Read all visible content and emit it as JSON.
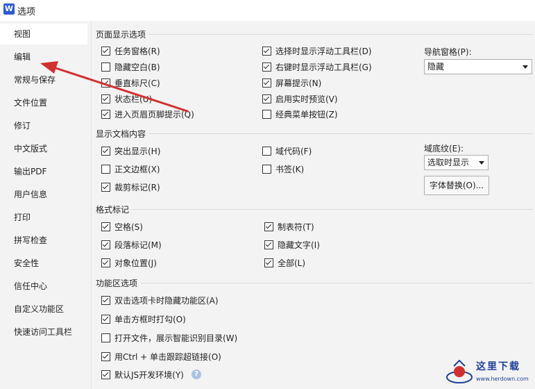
{
  "window": {
    "title": "选项",
    "app_icon": "W"
  },
  "sidebar": {
    "items": [
      {
        "label": "视图",
        "active": true
      },
      {
        "label": "编辑"
      },
      {
        "label": "常规与保存"
      },
      {
        "label": "文件位置"
      },
      {
        "label": "修订"
      },
      {
        "label": "中文版式"
      },
      {
        "label": "输出PDF"
      },
      {
        "label": "用户信息"
      },
      {
        "label": "打印"
      },
      {
        "label": "拼写检查"
      },
      {
        "label": "安全性"
      },
      {
        "label": "信任中心"
      },
      {
        "label": "自定义功能区"
      },
      {
        "label": "快速访问工具栏"
      }
    ]
  },
  "page_display": {
    "title": "页面显示选项",
    "left": [
      {
        "label": "任务窗格(R)",
        "checked": true
      },
      {
        "label": "隐藏空白(B)",
        "checked": false
      },
      {
        "label": "垂直标尺(C)",
        "checked": true
      },
      {
        "label": "状态栏(U)",
        "checked": true
      },
      {
        "label": "进入页眉页脚提示(Q)",
        "checked": true
      }
    ],
    "right": [
      {
        "label": "选择时显示浮动工具栏(D)",
        "checked": true
      },
      {
        "label": "右键时显示浮动工具栏(G)",
        "checked": true
      },
      {
        "label": "屏幕提示(N)",
        "checked": true
      },
      {
        "label": "启用实时预览(V)",
        "checked": true
      },
      {
        "label": "经典菜单按钮(Z)",
        "checked": false
      }
    ],
    "nav_pane_label": "导航窗格(P):",
    "nav_pane_value": "隐藏"
  },
  "doc_content": {
    "title": "显示文档内容",
    "left": [
      {
        "label": "突出显示(H)",
        "checked": true
      },
      {
        "label": "正文边框(X)",
        "checked": false
      },
      {
        "label": "裁剪标记(R)",
        "checked": true
      }
    ],
    "right": [
      {
        "label": "域代码(F)",
        "checked": false
      },
      {
        "label": "书签(K)",
        "checked": false
      }
    ],
    "field_shading_label": "域底纹(E):",
    "field_shading_value": "选取时显示",
    "font_replace_button": "字体替换(O)..."
  },
  "format_marks": {
    "title": "格式标记",
    "left": [
      {
        "label": "空格(S)",
        "checked": true
      },
      {
        "label": "段落标记(M)",
        "checked": true
      },
      {
        "label": "对象位置(J)",
        "checked": true
      }
    ],
    "right": [
      {
        "label": "制表符(T)",
        "checked": true
      },
      {
        "label": "隐藏文字(I)",
        "checked": true
      },
      {
        "label": "全部(L)",
        "checked": true
      }
    ]
  },
  "ribbon": {
    "title": "功能区选项",
    "items": [
      {
        "label": "双击选项卡时隐藏功能区(A)",
        "checked": true
      },
      {
        "label": "单击方框时打勾(O)",
        "checked": true
      },
      {
        "label": "打开文件，展示智能识别目录(W)",
        "checked": false
      },
      {
        "label": "用Ctrl + 单击跟踪超链接(O)",
        "checked": true
      },
      {
        "label": "默认JS开发环境(Y)",
        "checked": true
      }
    ],
    "help_icon_glyph": "?"
  },
  "watermark": {
    "text": "这里下载",
    "url": "www.herdown.com"
  },
  "colors": {
    "annotation_arrow": "#d32f2f",
    "sidebar_bg": "#f3f3f3",
    "active_item_bg": "#ffffff"
  },
  "icons": {
    "help": "help-icon",
    "dropdown": "chevron-down-icon",
    "check": "check-icon"
  }
}
